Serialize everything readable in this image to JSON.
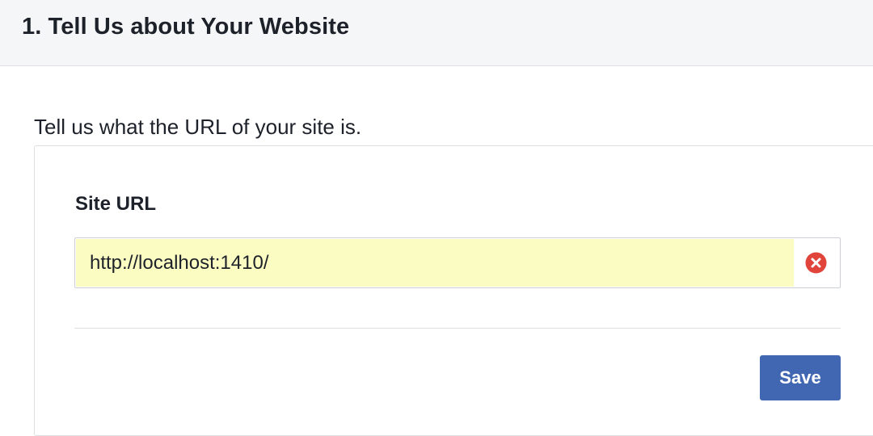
{
  "header": {
    "title": "1. Tell Us about Your Website"
  },
  "intro": {
    "text": "Tell us what the URL of your site is."
  },
  "form": {
    "site_url_label": "Site URL",
    "site_url_value": "http://localhost:1410/",
    "clear_icon": "clear-icon",
    "save_label": "Save"
  },
  "colors": {
    "header_bg": "#f5f6f7",
    "input_autofill_bg": "#fbfcc2",
    "clear_icon": "#e0443b",
    "save_button": "#4267b2"
  }
}
